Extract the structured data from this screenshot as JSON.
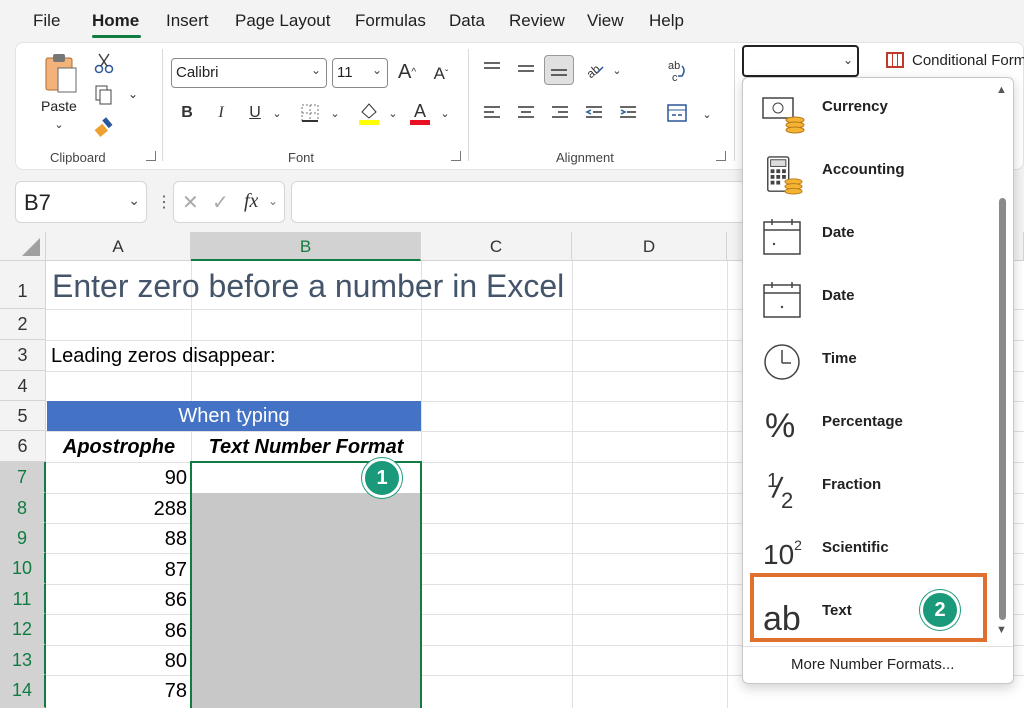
{
  "menu": {
    "tabs": [
      "File",
      "Home",
      "Insert",
      "Page Layout",
      "Formulas",
      "Data",
      "Review",
      "View",
      "Help"
    ],
    "active": "Home"
  },
  "ribbon": {
    "clipboard": {
      "label": "Clipboard",
      "paste": "Paste"
    },
    "font": {
      "label": "Font",
      "family": "Calibri",
      "size": "11",
      "grow": "A",
      "shrink": "A",
      "bold": "B",
      "italic": "I",
      "underline": "U",
      "fill_color": "#ffff00",
      "font_color": "#e81123",
      "font_glyph": "A"
    },
    "alignment": {
      "label": "Alignment"
    },
    "number_format_value": "",
    "conditional_formatting": "Conditional Form"
  },
  "formula_bar": {
    "name_box": "B7",
    "fx": "fx",
    "formula": ""
  },
  "sheet": {
    "columns": [
      "A",
      "B",
      "C",
      "D"
    ],
    "rows": [
      "1",
      "2",
      "3",
      "4",
      "5",
      "6",
      "7",
      "8",
      "9",
      "10",
      "11",
      "12",
      "13",
      "14"
    ],
    "selected_column": "B",
    "title": "Enter zero before a number in Excel",
    "row3": "Leading zeros disappear:",
    "banner": "When typing",
    "header_a": "Apostrophe",
    "header_b": "Text Number Format",
    "values_a": [
      "90",
      "288",
      "88",
      "87",
      "86",
      "86",
      "80",
      "78"
    ]
  },
  "dropdown": {
    "items": [
      {
        "label": "Currency",
        "icon": "currency-icon"
      },
      {
        "label": "Accounting",
        "icon": "accounting-icon"
      },
      {
        "label": "Date",
        "icon": "short-date-icon"
      },
      {
        "label": "Date",
        "icon": "long-date-icon"
      },
      {
        "label": "Time",
        "icon": "clock-icon"
      },
      {
        "label": "Percentage",
        "icon": "percent-icon"
      },
      {
        "label": "Fraction",
        "icon": "fraction-icon"
      },
      {
        "label": "Scientific",
        "icon": "scientific-icon"
      },
      {
        "label": "Text",
        "icon": "text-ab-icon"
      }
    ],
    "more": "More Number Formats...",
    "percent_glyph": "%",
    "fraction_num": "1",
    "fraction_den": "2",
    "sci_base": "10",
    "sci_exp": "2",
    "text_glyph": "ab"
  },
  "badges": {
    "one": "1",
    "two": "2"
  },
  "colors": {
    "excel_green": "#107c41",
    "banner_blue": "#4472c4",
    "highlight_orange": "#e07030",
    "badge_teal": "#1a9a7a"
  }
}
